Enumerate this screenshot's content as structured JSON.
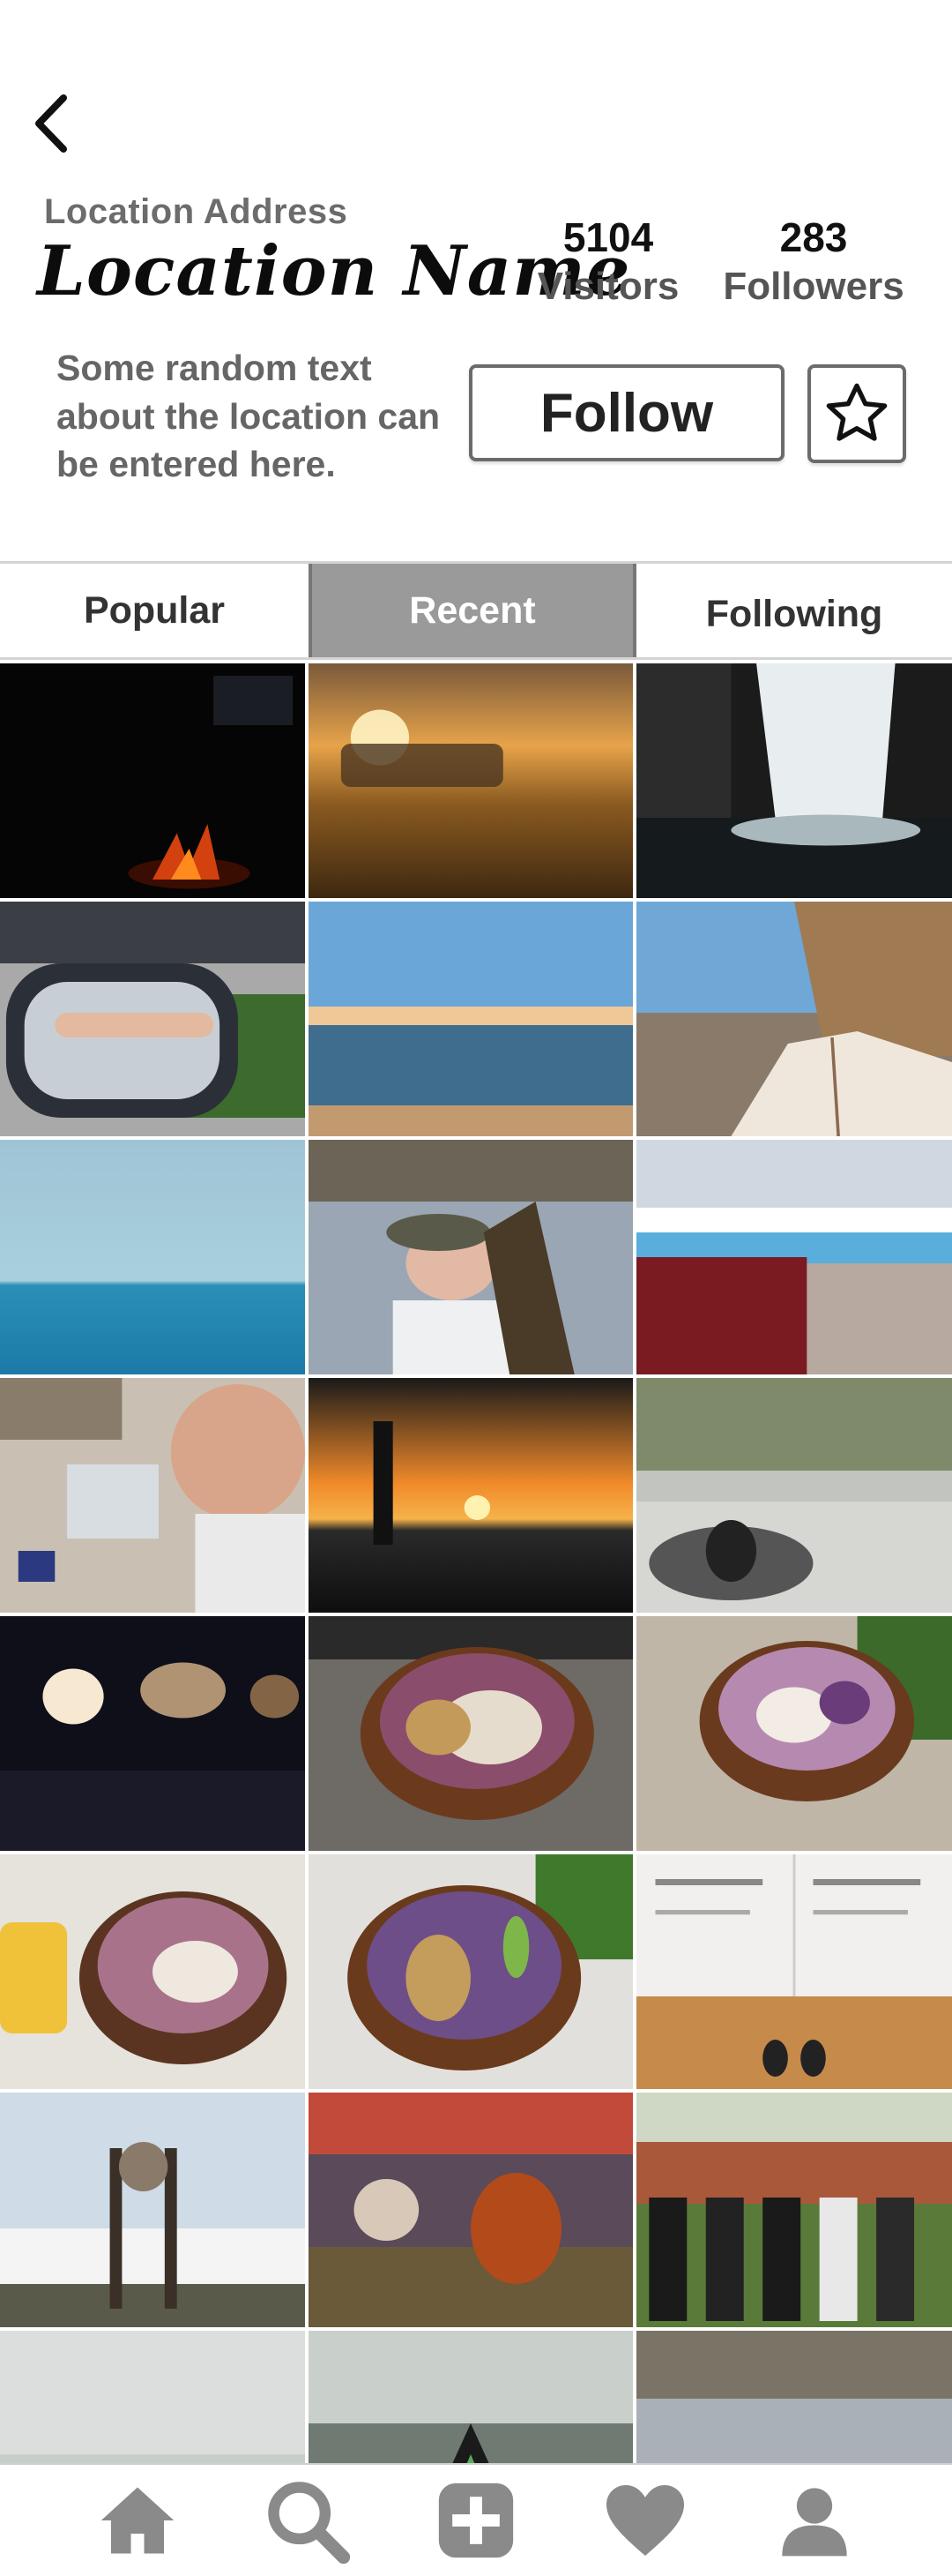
{
  "header": {
    "back_icon": "chevron-left-icon",
    "location_address": "Location Address",
    "location_name": "Location Name",
    "visitors": {
      "count": "5104",
      "label": "Visitors"
    },
    "followers": {
      "count": "283",
      "label": "Followers"
    },
    "description": "Some random text about the location can be entered here.",
    "follow_label": "Follow",
    "star_icon": "star-icon"
  },
  "tabs": [
    {
      "label": "Popular",
      "active": false
    },
    {
      "label": "Recent",
      "active": true
    },
    {
      "label": "Following",
      "active": false
    }
  ],
  "grid": {
    "photos": [
      "campfire at night",
      "sunset behind truck",
      "waterfall",
      "arm out car mirror",
      "beach shoreline",
      "reading on hammock",
      "ocean horizon",
      "woman in boat",
      "pool with laptop",
      "selfie with laptop",
      "sunset silhouette palm",
      "person in garden pond",
      "airplane cabin windows",
      "acai bowl",
      "acai bowl in hand",
      "acai bowl with candle",
      "acai bowl with greens",
      "magazine and shoes",
      "sign above clouds",
      "festival crowd",
      "dancers in group",
      "misty field",
      "a-frame in forest",
      "person in boat"
    ]
  },
  "bottom_nav": [
    {
      "name": "home-icon"
    },
    {
      "name": "search-icon"
    },
    {
      "name": "add-icon"
    },
    {
      "name": "heart-icon"
    },
    {
      "name": "profile-icon"
    }
  ],
  "colors": {
    "tab_active_bg": "#9a9a9a",
    "nav_icon": "#8a8a8a",
    "border": "#6b6b6b"
  }
}
